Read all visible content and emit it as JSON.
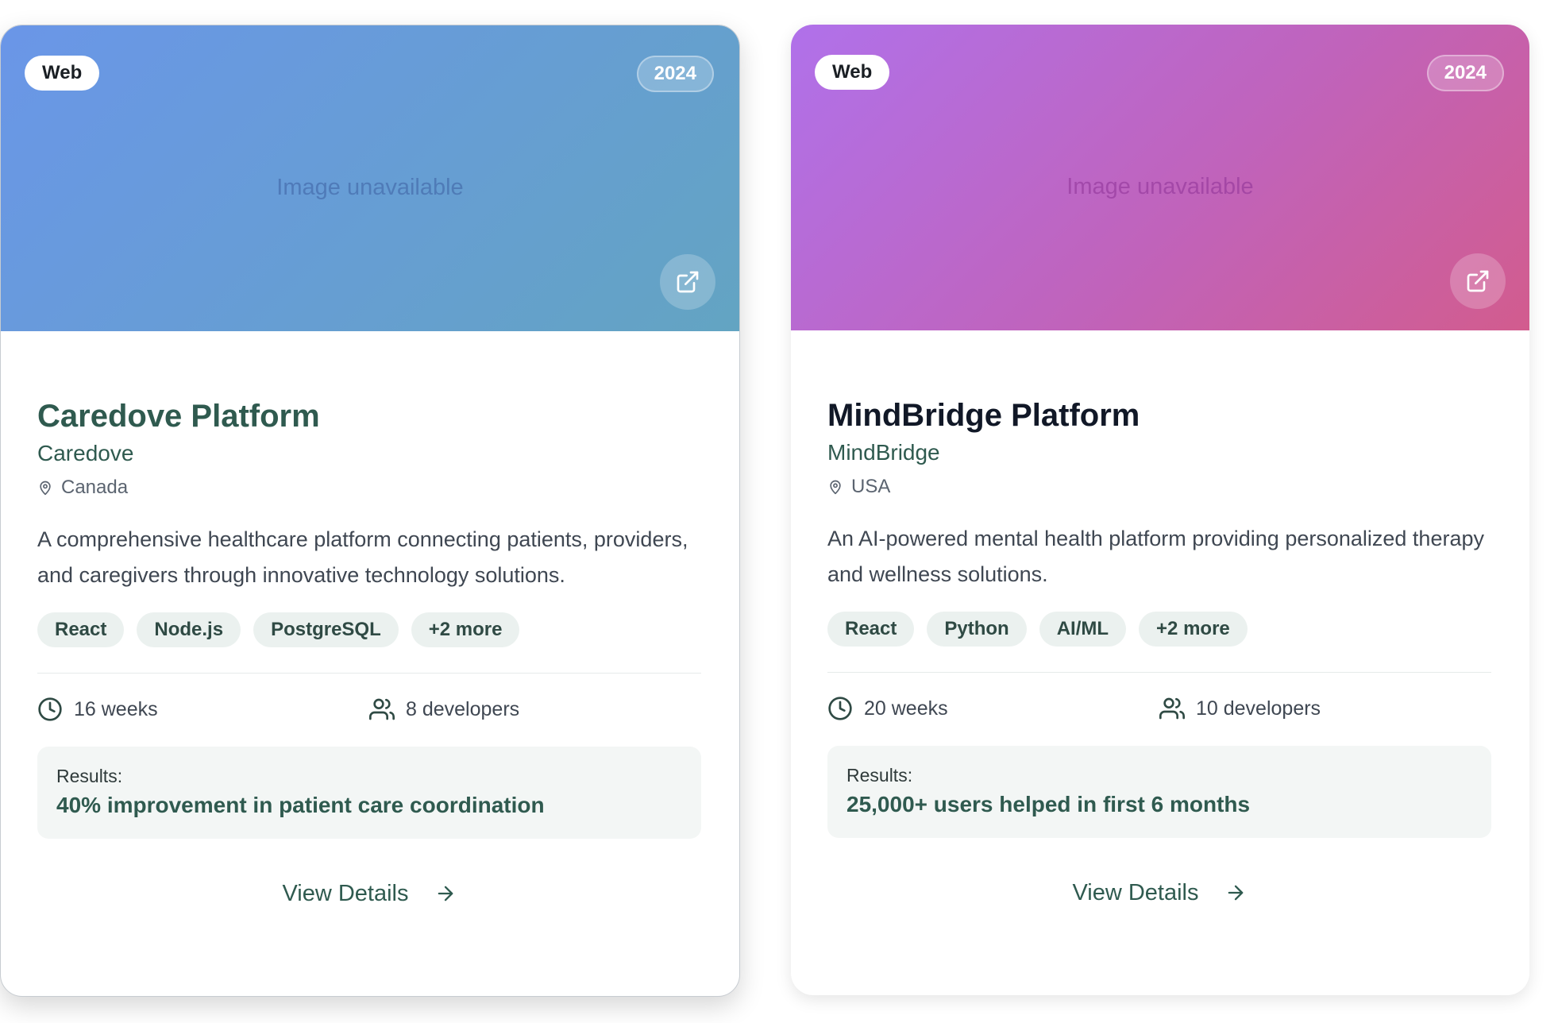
{
  "projects": [
    {
      "category": "Web",
      "year": "2024",
      "image_message": "Image unavailable",
      "title": "Caredove Platform",
      "client": "Caredove",
      "location": "Canada",
      "description": "A comprehensive healthcare platform connecting patients, providers, and caregivers through innovative technology solutions.",
      "tags": [
        "React",
        "Node.js",
        "PostgreSQL",
        "+2 more"
      ],
      "duration": "16 weeks",
      "team": "8 developers",
      "results_label": "Results:",
      "results_value": "40% improvement in patient care coordination",
      "cta": "View Details"
    },
    {
      "category": "Web",
      "year": "2024",
      "image_message": "Image unavailable",
      "title": "MindBridge Platform",
      "client": "MindBridge",
      "location": "USA",
      "description": "An AI-powered mental health platform providing personalized therapy and wellness solutions.",
      "tags": [
        "React",
        "Python",
        "AI/ML",
        "+2 more"
      ],
      "duration": "20 weeks",
      "team": "10 developers",
      "results_label": "Results:",
      "results_value": "25,000+ users helped in first 6 months",
      "cta": "View Details"
    }
  ],
  "icons": {
    "external_link": "external-link-icon",
    "location": "map-pin-icon",
    "duration": "clock-icon",
    "team": "users-icon",
    "cta": "arrow-right-icon"
  },
  "colors": {
    "accent": "#2f5a4f",
    "card0_gradient": [
      "#6a96e8",
      "#63a4c2"
    ],
    "card1_gradient": [
      "#b071ea",
      "#d25c8e"
    ]
  }
}
